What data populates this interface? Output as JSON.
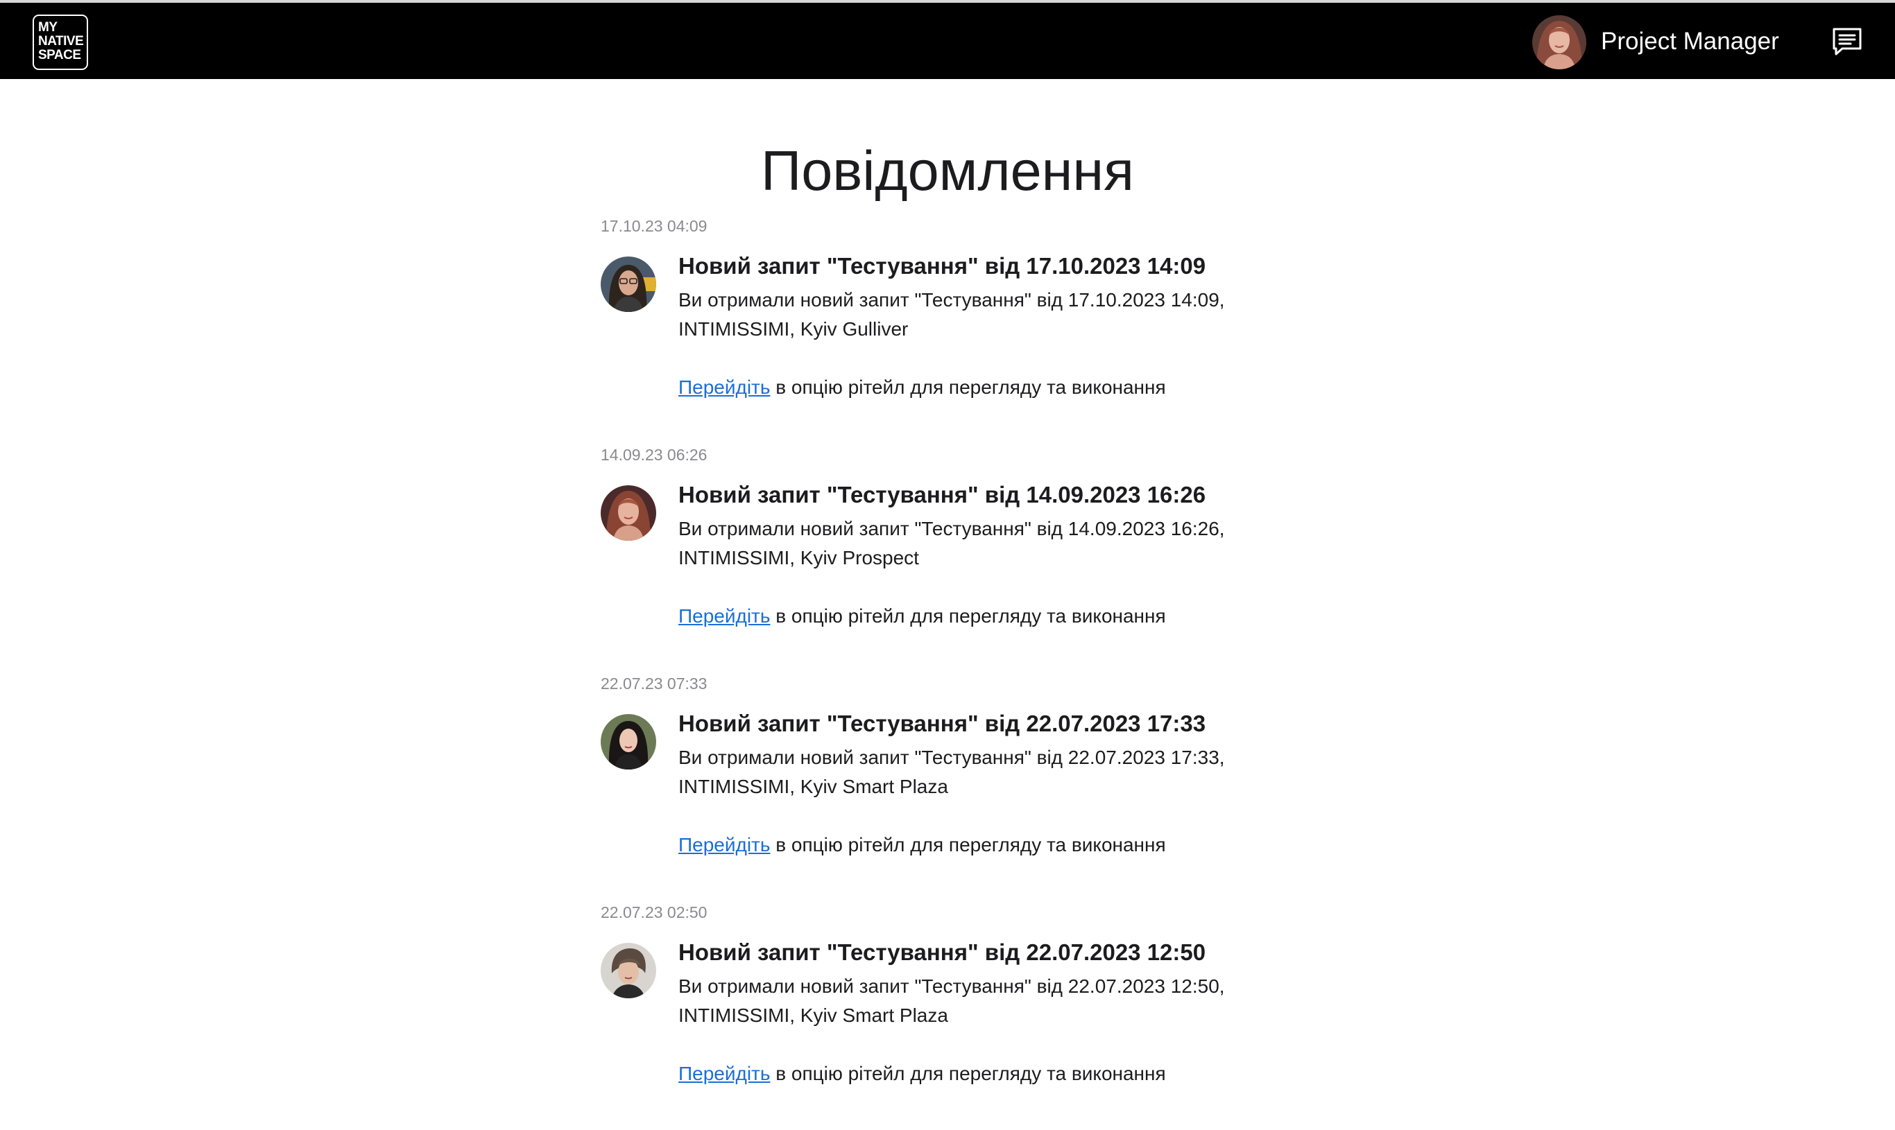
{
  "header": {
    "logo": {
      "line1": "MY",
      "line2": "NATIVE",
      "line3": "SPACE"
    },
    "user_name": "Project Manager",
    "chat_icon": "message-square-icon"
  },
  "page": {
    "title": "Повідомлення"
  },
  "link_color": "#1a6ed8",
  "notifications": [
    {
      "time": "17.10.23 04:09",
      "title": "Новий запит \"Тестування\" від 17.10.2023 14:09",
      "body": "Ви отримали новий запит \"Тестування\" від 17.10.2023 14:09, INTIMISSIMI, Kyiv Gulliver",
      "link_text": "Перейдіть",
      "link_suffix": " в опцію рітейл для перегляду та виконання"
    },
    {
      "time": "14.09.23 06:26",
      "title": "Новий запит \"Тестування\" від 14.09.2023 16:26",
      "body": "Ви отримали новий запит \"Тестування\" від 14.09.2023 16:26, INTIMISSIMI, Kyiv Prospect",
      "link_text": "Перейдіть",
      "link_suffix": " в опцію рітейл для перегляду та виконання"
    },
    {
      "time": "22.07.23 07:33",
      "title": "Новий запит \"Тестування\" від 22.07.2023 17:33",
      "body": "Ви отримали новий запит \"Тестування\" від 22.07.2023 17:33, INTIMISSIMI, Kyiv Smart Plaza",
      "link_text": "Перейдіть",
      "link_suffix": " в опцію рітейл для перегляду та виконання"
    },
    {
      "time": "22.07.23 02:50",
      "title": "Новий запит \"Тестування\" від 22.07.2023 12:50",
      "body": "Ви отримали новий запит \"Тестування\" від 22.07.2023 12:50, INTIMISSIMI, Kyiv Smart Plaza",
      "link_text": "Перейдіть",
      "link_suffix": " в опцію рітейл для перегляду та виконання"
    }
  ]
}
